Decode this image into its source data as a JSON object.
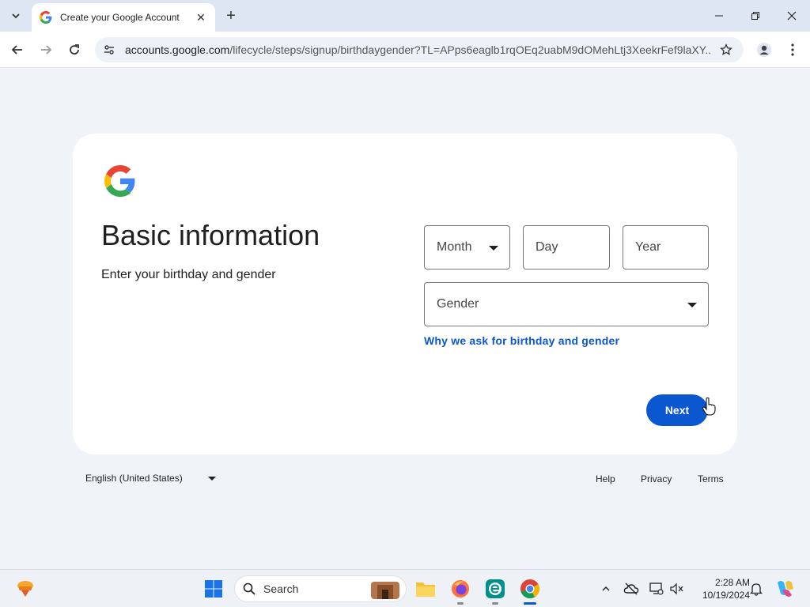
{
  "browser": {
    "tab_title": "Create your Google Account",
    "url_domain": "accounts.google.com",
    "url_path": "/lifecycle/steps/signup/birthdaygender?TL=APps6eaglb1rqOEq2uabM9dOMehLtj3XeekrFef9laXY..."
  },
  "page": {
    "title": "Basic information",
    "subtitle": "Enter your birthday and gender",
    "month_placeholder": "Month",
    "day_placeholder": "Day",
    "year_placeholder": "Year",
    "gender_placeholder": "Gender",
    "why_link": "Why we ask for birthday and gender",
    "next_label": "Next"
  },
  "footer": {
    "language": "English (United States)",
    "help": "Help",
    "privacy": "Privacy",
    "terms": "Terms"
  },
  "taskbar": {
    "search_label": "Search",
    "time": "2:28 AM",
    "date": "10/19/2024"
  },
  "colors": {
    "accent": "#0b57d0",
    "page_background": "#f0f4f9",
    "card_background": "#ffffff"
  }
}
